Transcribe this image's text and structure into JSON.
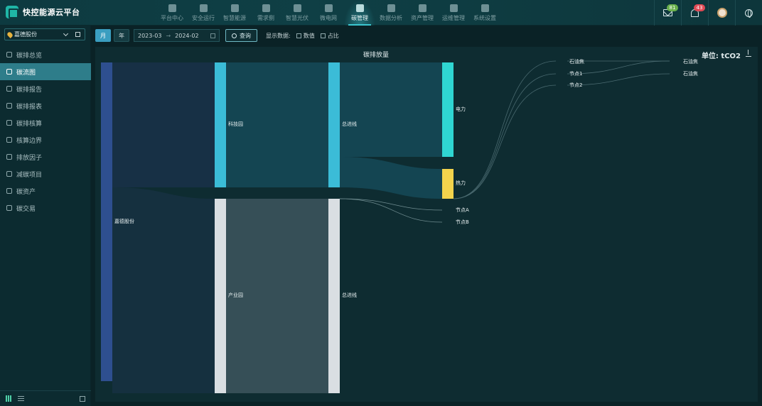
{
  "app": {
    "title": "快控能源云平台"
  },
  "nav": [
    {
      "label": "平台中心",
      "icon": "platform-icon",
      "active": false
    },
    {
      "label": "安全运行",
      "icon": "shield-icon",
      "active": false
    },
    {
      "label": "智慧能源",
      "icon": "recycle-icon",
      "active": false
    },
    {
      "label": "需求侧",
      "icon": "server-icon",
      "active": false
    },
    {
      "label": "智慧光伏",
      "icon": "solar-panel-icon",
      "active": false
    },
    {
      "label": "微电网",
      "icon": "grid-network-icon",
      "active": false
    },
    {
      "label": "碳管理",
      "icon": "leaf-icon",
      "active": true
    },
    {
      "label": "数据分析",
      "icon": "pie-chart-icon",
      "active": false
    },
    {
      "label": "资产管理",
      "icon": "database-icon",
      "active": false
    },
    {
      "label": "运维管理",
      "icon": "tools-icon",
      "active": false
    },
    {
      "label": "系统设置",
      "icon": "settings-icon",
      "active": false
    }
  ],
  "header_right": {
    "mail_count": "81",
    "alert_count": "43"
  },
  "sidebar": {
    "org": "嘉德股份",
    "items": [
      {
        "label": "碳排总览",
        "icon": "recycle-icon",
        "active": false
      },
      {
        "label": "碳流图",
        "icon": "flow-chart-icon",
        "active": true
      },
      {
        "label": "碳排报告",
        "icon": "document-icon",
        "active": false
      },
      {
        "label": "碳排报表",
        "icon": "table-icon",
        "active": false
      },
      {
        "label": "碳排核算",
        "icon": "calculate-icon",
        "active": false
      },
      {
        "label": "核算边界",
        "icon": "edit-icon",
        "active": false
      },
      {
        "label": "排放因子",
        "icon": "factor-icon",
        "active": false
      },
      {
        "label": "减碳项目",
        "icon": "project-icon",
        "active": false
      },
      {
        "label": "碳资产",
        "icon": "asset-icon",
        "active": false
      },
      {
        "label": "碳交易",
        "icon": "trade-icon",
        "active": false
      }
    ]
  },
  "filter": {
    "month_label": "月",
    "year_label": "年",
    "date_start": "2023-03",
    "date_end": "2024-02",
    "arrow": "→",
    "query_label": "查询",
    "show_data_label": "显示数据:",
    "value_label": "数值",
    "ratio_label": "占比"
  },
  "chart": {
    "title": "碳排放量",
    "unit": "单位: tCO2"
  },
  "chart_data": {
    "type": "sankey",
    "title": "碳排放量",
    "unit": "单位: tCO2",
    "nodes": [
      "嘉德股份",
      "科技园",
      "产业园",
      "总进线",
      "总进线",
      "电力",
      "热力",
      "节点A",
      "节点B",
      "石油焦",
      "节点1",
      "节点2",
      "石油焦",
      "石油焦"
    ],
    "links": [
      {
        "source": "嘉德股份",
        "target": "科技园",
        "value": 0.4
      },
      {
        "source": "嘉德股份",
        "target": "产业园",
        "value": 0.6
      },
      {
        "source": "科技园",
        "target": "总进线",
        "value": 0.4
      },
      {
        "source": "产业园",
        "target": "总进线",
        "value": 0.6
      },
      {
        "source": "总进线",
        "target": "电力",
        "value": 0.3
      },
      {
        "source": "总进线",
        "target": "热力",
        "value": 0.1
      },
      {
        "source": "总进线",
        "target": "节点A",
        "value": 0.001
      },
      {
        "source": "总进线",
        "target": "节点B",
        "value": 0.001
      },
      {
        "source": "热力",
        "target": "石油焦",
        "value": 0.001
      },
      {
        "source": "节点1",
        "target": "石油焦",
        "value": 0.001
      },
      {
        "source": "节点2",
        "target": "石油焦",
        "value": 0.001
      }
    ]
  }
}
